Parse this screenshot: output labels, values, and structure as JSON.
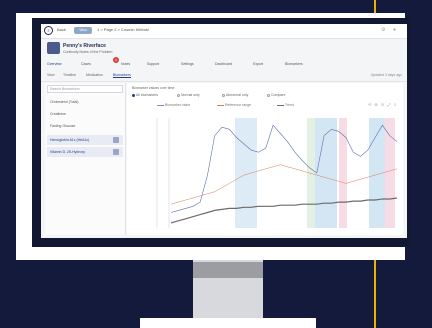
{
  "app": {
    "back_label": "Back",
    "view_label": "View",
    "breadcrumb": "1 > Page 2 > Cosmin Kibbutz"
  },
  "patient": {
    "name": "Penny's Riverface",
    "subtitle": "Continuity Notes of the Problem"
  },
  "tabs": [
    {
      "label": "Overview"
    },
    {
      "label": "Cases"
    },
    {
      "label": "Notes"
    },
    {
      "label": "Support"
    },
    {
      "label": "Settings"
    },
    {
      "label": "Dashboard"
    },
    {
      "label": "Export"
    },
    {
      "label": "Biomarkers"
    }
  ],
  "tab_badge": "2",
  "subtabs": [
    {
      "label": "View"
    },
    {
      "label": "Timeline"
    },
    {
      "label": "Medication"
    },
    {
      "label": "Biomarkers"
    }
  ],
  "subtab_right": "Updated 3 days ago",
  "sidebar": {
    "search_placeholder": "Search Biomarkers",
    "items": [
      {
        "label": "Cholesterol (Total)"
      },
      {
        "label": "Creatinine"
      },
      {
        "label": "Fasting Glucose"
      },
      {
        "label": "Hemoglobin A1c (HbA1c)"
      },
      {
        "label": "Vitamin D, 25-Hydroxy"
      }
    ]
  },
  "main": {
    "title": "Biomarker values over time",
    "radios": [
      {
        "label": "All biomarkers"
      },
      {
        "label": "Normal only"
      },
      {
        "label": "Abnormal only"
      },
      {
        "label": "Compare"
      }
    ],
    "legend": [
      {
        "label": "Biomarker value",
        "color": "#7a8fc4"
      },
      {
        "label": "Reference range",
        "color": "#d77c5a"
      },
      {
        "label": "Trend",
        "color": "#6b6b6b"
      }
    ],
    "toolbar": "⟲ ⊕ ⊖ ⤢ ⇩"
  },
  "colors": {
    "band_blue": "#9cc7e6",
    "band_pink": "#f3c4d4",
    "band_green": "#c6e4c6",
    "accent": "#e8b400"
  },
  "chart_data": {
    "type": "line",
    "title": "",
    "xlabel": "",
    "ylabel": "",
    "series": [
      {
        "values": [
          12,
          14,
          16,
          18,
          22,
          48,
          86,
          94,
          92,
          84,
          78,
          72,
          70,
          74,
          96,
          88,
          80,
          70,
          62,
          55,
          50,
          86,
          92,
          90,
          84,
          70,
          66,
          72,
          84,
          96,
          86,
          80
        ]
      },
      {
        "values": [
          20,
          22,
          24,
          26,
          28,
          30,
          32,
          36,
          40,
          44,
          48,
          50,
          52,
          54,
          56,
          58,
          56,
          54,
          52,
          50,
          48,
          46,
          44,
          42,
          40,
          42,
          44,
          46,
          48,
          50,
          52,
          54
        ]
      },
      {
        "values": [
          2,
          4,
          6,
          8,
          10,
          12,
          14,
          15,
          16,
          16,
          17,
          17,
          18,
          18,
          18,
          19,
          19,
          19,
          20,
          20,
          20,
          21,
          21,
          22,
          22,
          23,
          23,
          24,
          24,
          25,
          25,
          26
        ]
      }
    ],
    "ylim": [
      0,
      100
    ]
  }
}
